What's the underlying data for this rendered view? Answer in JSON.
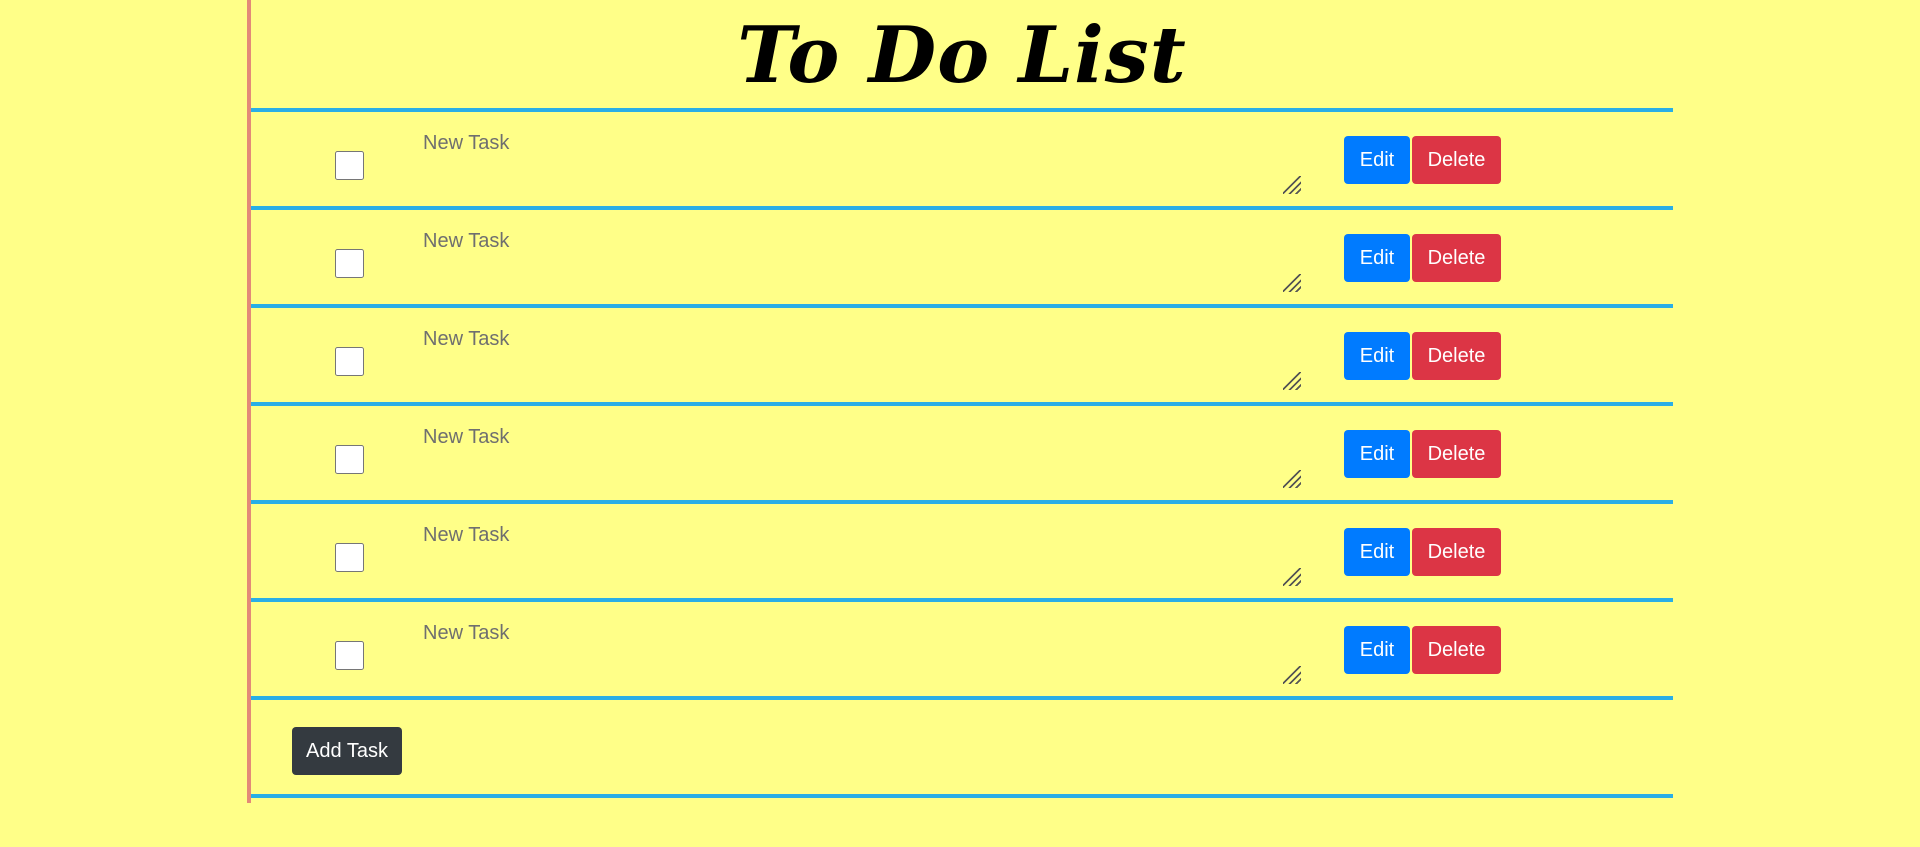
{
  "page": {
    "title": "To Do List"
  },
  "tasks": [
    {
      "placeholder": "New Task",
      "checked": false,
      "edit_label": "Edit",
      "delete_label": "Delete"
    },
    {
      "placeholder": "New Task",
      "checked": false,
      "edit_label": "Edit",
      "delete_label": "Delete"
    },
    {
      "placeholder": "New Task",
      "checked": false,
      "edit_label": "Edit",
      "delete_label": "Delete"
    },
    {
      "placeholder": "New Task",
      "checked": false,
      "edit_label": "Edit",
      "delete_label": "Delete"
    },
    {
      "placeholder": "New Task",
      "checked": false,
      "edit_label": "Edit",
      "delete_label": "Delete"
    },
    {
      "placeholder": "New Task",
      "checked": false,
      "edit_label": "Edit",
      "delete_label": "Delete"
    }
  ],
  "actions": {
    "add_task_label": "Add Task"
  },
  "colors": {
    "background": "#ffff88",
    "rule_line": "#2aaee6",
    "margin_line": "#e38a78",
    "edit_button": "#007bff",
    "delete_button": "#dc3545",
    "add_button": "#343a40"
  }
}
